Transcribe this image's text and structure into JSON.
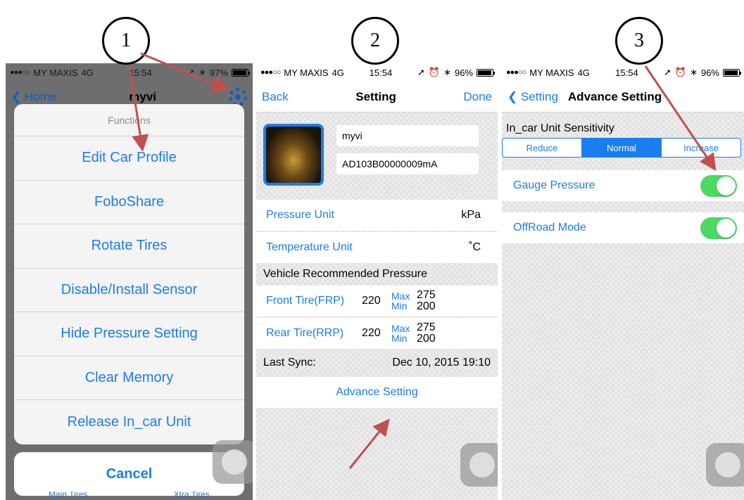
{
  "steps": [
    "1",
    "2",
    "3"
  ],
  "panel1": {
    "status": {
      "carrier": "MY MAXIS",
      "network": "4G",
      "time": "15:54",
      "battery": "97%"
    },
    "nav": {
      "back": "Home",
      "title": "myvi"
    },
    "sheet_title": "Functions",
    "items": [
      "Edit Car Profile",
      "FoboShare",
      "Rotate Tires",
      "Disable/Install Sensor",
      "Hide Pressure Setting",
      "Clear Memory",
      "Release In_car Unit"
    ],
    "cancel": "Cancel",
    "tabs": [
      "Main Tires",
      "Xtra Tires"
    ]
  },
  "panel2": {
    "status": {
      "carrier": "MY MAXIS",
      "network": "4G",
      "time": "15:54",
      "battery": "96%"
    },
    "nav": {
      "back": "Back",
      "title": "Setting",
      "done": "Done"
    },
    "car_name": "myvi",
    "car_id": "AD103B00000009mA",
    "pressure_unit": {
      "label": "Pressure Unit",
      "value": "kPa"
    },
    "temperature_unit": {
      "label": "Temperature Unit",
      "value": "˚C"
    },
    "recommended_label": "Vehicle Recommended Pressure",
    "max_label": "Max",
    "min_label": "Min",
    "front": {
      "label": "Front Tire(FRP)",
      "value": "220",
      "max": "275",
      "min": "200"
    },
    "rear": {
      "label": "Rear Tire(RRP)",
      "value": "220",
      "max": "275",
      "min": "200"
    },
    "last_sync": {
      "label": "Last Sync:",
      "value": "Dec 10, 2015  19:10"
    },
    "advance": "Advance Setting"
  },
  "panel3": {
    "status": {
      "carrier": "MY MAXIS",
      "network": "4G",
      "time": "15:54",
      "battery": "96%"
    },
    "nav": {
      "back": "Setting",
      "title": "Advance Setting"
    },
    "sensitivity_label": "In_car Unit Sensitivity",
    "segments": [
      "Reduce",
      "Normal",
      "Increase"
    ],
    "selected_segment": "Normal",
    "gauge_pressure": {
      "label": "Gauge Pressure",
      "on": true
    },
    "offroad": {
      "label": "OffRoad Mode",
      "on": true
    }
  },
  "colors": {
    "accent": "#1a7df0",
    "toggle_on": "#4cd964",
    "arrow": "#c0504d"
  }
}
